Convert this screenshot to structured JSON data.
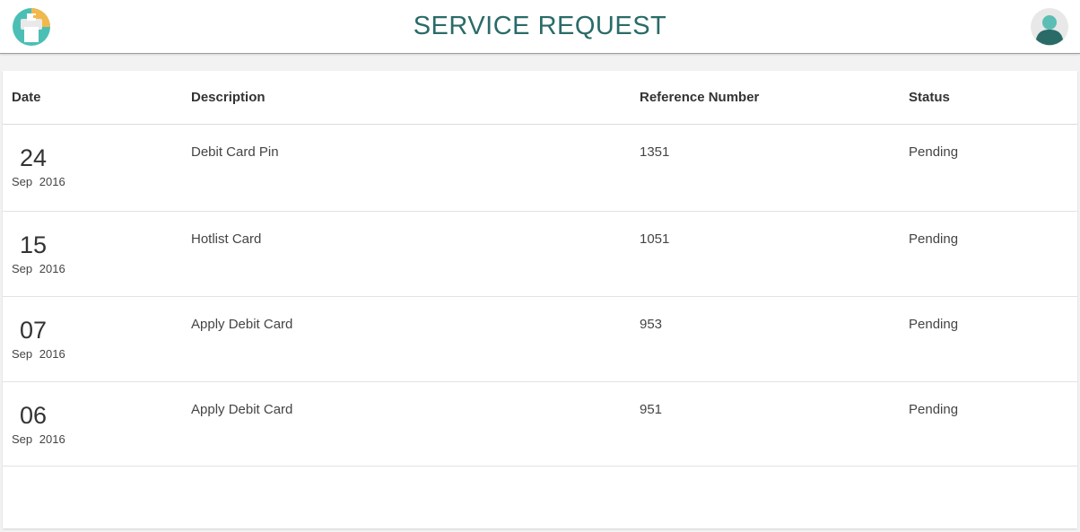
{
  "header": {
    "title": "SERVICE REQUEST",
    "logo_icon": "printer-logo-icon",
    "avatar_icon": "user-avatar-icon",
    "accent_color": "#2a6b68"
  },
  "table": {
    "columns": {
      "date": "Date",
      "description": "Description",
      "reference": "Reference Number",
      "status": "Status"
    },
    "rows": [
      {
        "day": "24",
        "month": "Sep",
        "year": "2016",
        "description": "Debit Card Pin",
        "reference": "1351",
        "status": "Pending"
      },
      {
        "day": "15",
        "month": "Sep",
        "year": "2016",
        "description": "Hotlist Card",
        "reference": "1051",
        "status": "Pending"
      },
      {
        "day": "07",
        "month": "Sep",
        "year": "2016",
        "description": "Apply Debit Card",
        "reference": "953",
        "status": "Pending"
      },
      {
        "day": "06",
        "month": "Sep",
        "year": "2016",
        "description": "Apply Debit Card",
        "reference": "951",
        "status": "Pending"
      }
    ]
  }
}
